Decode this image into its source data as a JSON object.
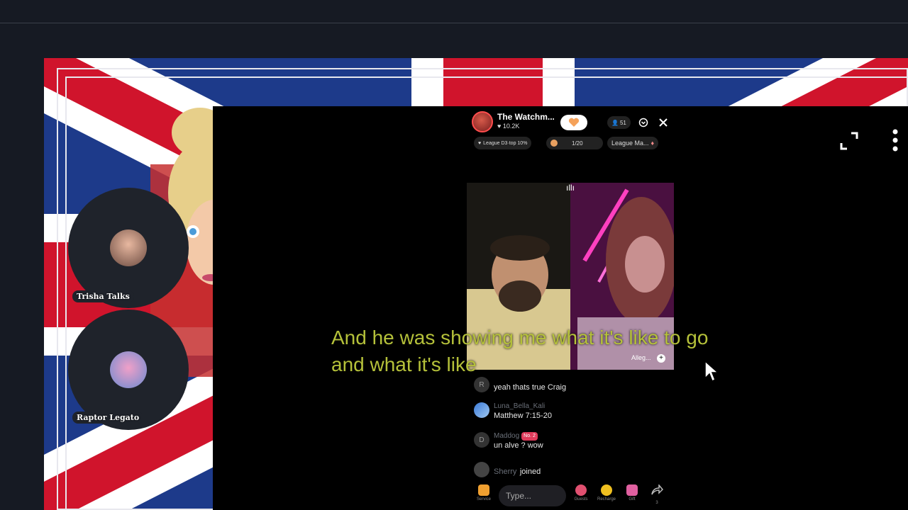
{
  "host": {
    "name": "The Watchm...",
    "likes": "♥ 10.2K",
    "viewer_count": "51"
  },
  "pills": {
    "league": "League D3·top 10%",
    "progress": "1/20",
    "league_match": "League Ma..."
  },
  "guests": [
    {
      "name": "Trisha Talks"
    },
    {
      "name": "Raptor Legato"
    }
  ],
  "cam_right_label": "Alleg...",
  "caption": "And he was showing me what it's like to go and what it's like",
  "chat": [
    {
      "user": "",
      "avatar": "R",
      "message": "yeah thats true Craig"
    },
    {
      "user": "Luna_Bella_Kali",
      "avatar": "",
      "message": "Matthew 7:15-20"
    },
    {
      "user": "Maddog",
      "avatar": "D",
      "badge": "No. 2",
      "message": "un alve ? wow"
    },
    {
      "user": "Sherry",
      "avatar": "",
      "message": "joined"
    }
  ],
  "bottom": {
    "type_placeholder": "Type...",
    "tools": [
      {
        "label": "Service"
      },
      {
        "label": "Guests"
      },
      {
        "label": "Recharge"
      },
      {
        "label": "Gift"
      },
      {
        "label": "3"
      }
    ]
  },
  "colors": {
    "caption": "#b5c13a",
    "accent": "#ff4d4d",
    "flag_blue": "#1d3a8a",
    "flag_red": "#d0142c"
  }
}
